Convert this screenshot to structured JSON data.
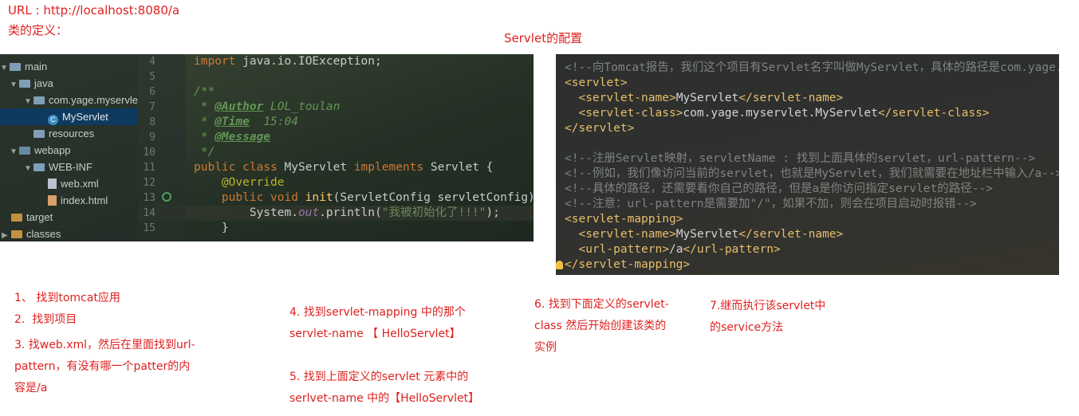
{
  "top_notes": {
    "url_line": "URL : http://localhost:8080/a",
    "class_def": "类的定义：",
    "servlet_config": "Servlet的配置"
  },
  "project_tree": [
    {
      "label": "main",
      "icon": "folder-icon",
      "arrow": "▼"
    },
    {
      "label": "java",
      "icon": "source-folder-icon",
      "arrow": "▼"
    },
    {
      "label": "com.yage.myservlet",
      "icon": "package-icon",
      "arrow": "▼"
    },
    {
      "label": "MyServlet",
      "icon": "class-icon",
      "arrow": "",
      "selected": true
    },
    {
      "label": "resources",
      "icon": "resources-folder-icon",
      "arrow": ""
    },
    {
      "label": "webapp",
      "icon": "web-folder-icon",
      "arrow": "▼"
    },
    {
      "label": "WEB-INF",
      "icon": "folder-icon",
      "arrow": "▼"
    },
    {
      "label": "web.xml",
      "icon": "xml-file-icon",
      "arrow": ""
    },
    {
      "label": "index.html",
      "icon": "html-file-icon",
      "arrow": ""
    },
    {
      "label": "target",
      "icon": "orange-folder-icon",
      "arrow": ""
    },
    {
      "label": "classes",
      "icon": "orange-folder-icon",
      "arrow": "▶"
    }
  ],
  "code_lines": [
    {
      "num": "4",
      "segs": [
        [
          "kw",
          "import"
        ],
        [
          "",
          " java.io.IOException;"
        ]
      ]
    },
    {
      "num": "5",
      "segs": [
        [
          "",
          ""
        ]
      ]
    },
    {
      "num": "6",
      "segs": [
        [
          "cm",
          "/**"
        ]
      ]
    },
    {
      "num": "7",
      "segs": [
        [
          "cm",
          " * "
        ],
        [
          "tag",
          "@Author"
        ],
        [
          "cm",
          " LOL_toulan"
        ]
      ]
    },
    {
      "num": "8",
      "segs": [
        [
          "cm",
          " * "
        ],
        [
          "tag",
          "@Time"
        ],
        [
          "cm",
          "  15:04"
        ]
      ]
    },
    {
      "num": "9",
      "segs": [
        [
          "cm",
          " * "
        ],
        [
          "tag",
          "@Message"
        ]
      ]
    },
    {
      "num": "10",
      "segs": [
        [
          "cm",
          " */"
        ]
      ]
    },
    {
      "num": "11",
      "segs": [
        [
          "kw",
          "public class "
        ],
        [
          "",
          "MyServlet "
        ],
        [
          "kw",
          "implements "
        ],
        [
          "",
          "Servlet {"
        ]
      ]
    },
    {
      "num": "12",
      "segs": [
        [
          "",
          "    "
        ],
        [
          "ann",
          "@Override"
        ]
      ]
    },
    {
      "num": "13",
      "segs": [
        [
          "",
          "    "
        ],
        [
          "kw",
          "public void "
        ],
        [
          "fn",
          "init"
        ],
        [
          "",
          "(ServletConfig servletConfig)"
        ]
      ]
    },
    {
      "num": "14",
      "segs": [
        [
          "",
          "        System."
        ],
        [
          "it",
          "out"
        ],
        [
          "",
          ".println("
        ],
        [
          "str",
          "\"我被初始化了!!!\""
        ],
        [
          "",
          ");"
        ]
      ]
    },
    {
      "num": "15",
      "segs": [
        [
          "",
          "    }"
        ]
      ]
    }
  ],
  "xml_lines": [
    [
      [
        "xc",
        "<!--向Tomcat报告，我们这个项目有Servlet名字叫做MyServlet，具体的路径是com.yage.myservlet.MyServlet-->"
      ]
    ],
    [
      [
        "xt",
        "<servlet>"
      ]
    ],
    [
      [
        "xv",
        "  "
      ],
      [
        "xt",
        "<servlet-name>"
      ],
      [
        "xv",
        "MyServlet"
      ],
      [
        "xt",
        "</servlet-name>"
      ]
    ],
    [
      [
        "xv",
        "  "
      ],
      [
        "xt",
        "<servlet-class>"
      ],
      [
        "xv",
        "com.yage.myservlet.MyServlet"
      ],
      [
        "xt",
        "</servlet-class>"
      ]
    ],
    [
      [
        "xt",
        "</servlet>"
      ]
    ],
    [
      [
        "xv",
        ""
      ]
    ],
    [
      [
        "xc",
        "<!--注册Servlet映射，servletName : 找到上面具体的servlet，url-pattern-->"
      ]
    ],
    [
      [
        "xc",
        "<!--例如，我们像访问当前的servlet，也就是MyServlet，我们就需要在地址栏中输入/a-->"
      ]
    ],
    [
      [
        "xc",
        "<!--具体的路径，还需要看你自己的路径，但是a是你访问指定servlet的路径-->"
      ]
    ],
    [
      [
        "xc",
        "<!--注意：url-pattern是需要加\"/\"，如果不加，则会在项目启动时报错-->"
      ]
    ],
    [
      [
        "xt",
        "<servlet-mapping>"
      ]
    ],
    [
      [
        "xv",
        "  "
      ],
      [
        "xt",
        "<servlet-name>"
      ],
      [
        "xv",
        "MyServlet"
      ],
      [
        "xt",
        "</servlet-name>"
      ]
    ],
    [
      [
        "xv",
        "  "
      ],
      [
        "xt",
        "<url-pattern>"
      ],
      [
        "xv",
        "/a"
      ],
      [
        "xt",
        "</url-pattern>"
      ]
    ],
    [
      [
        "xt",
        "</servlet-mapping>"
      ]
    ]
  ],
  "steps": {
    "s1": "1、 找到tomcat应用",
    "s2": "2.  找到项目",
    "s3_l1": "3. 找web.xml，然后在里面找到url-",
    "s3_l2": "pattern，有没有哪一个patter的内",
    "s3_l3": "容是/a",
    "s4_l1": "4. 找到servlet-mapping 中的那个",
    "s4_l2": "servlet-name 【 HelloServlet】",
    "s5_l1": "5. 找到上面定义的servlet 元素中的",
    "s5_l2": "serlvet-name 中的【HelloServlet】",
    "s6_l1": "6. 找到下面定义的servlet-",
    "s6_l2": "class 然后开始创建该类的",
    "s6_l3": "实例",
    "s7_l1": "7.继而执行该servlet中",
    "s7_l2": "的service方法"
  }
}
